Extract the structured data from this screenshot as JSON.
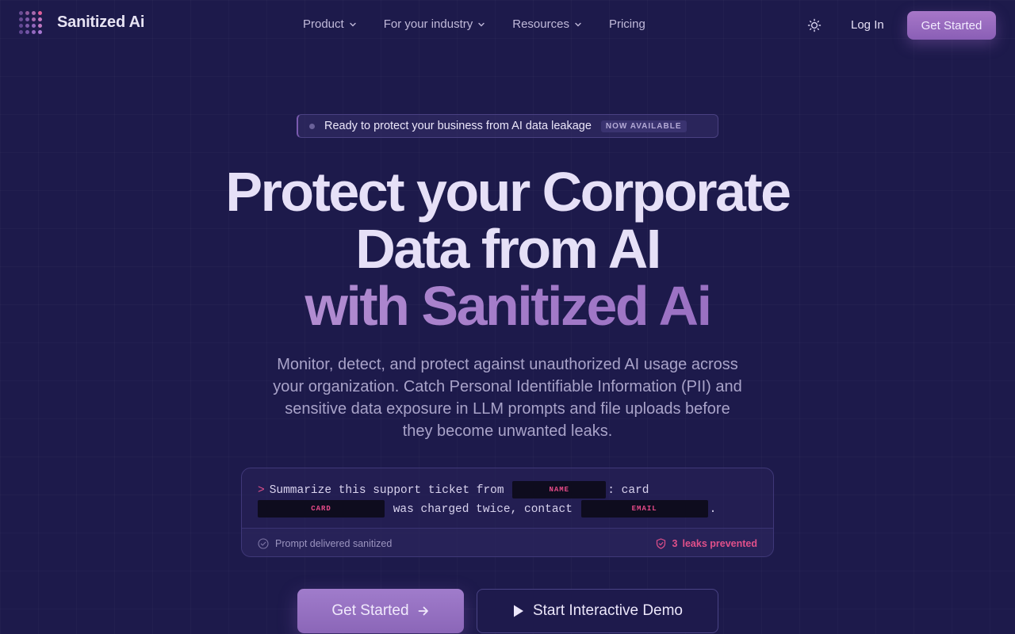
{
  "brand": {
    "name": "Sanitized Ai",
    "logo_colors": [
      "#9a6fcf",
      "#a878d2",
      "#c078c0",
      "#e05f9a"
    ]
  },
  "nav": {
    "links": [
      {
        "label": "Product",
        "has_dropdown": true
      },
      {
        "label": "For your industry",
        "has_dropdown": true
      },
      {
        "label": "Resources",
        "has_dropdown": true
      },
      {
        "label": "Pricing",
        "has_dropdown": false
      }
    ],
    "theme_icon": "sun-icon",
    "login_label": "Log In",
    "cta_label": "Get Started"
  },
  "badge": {
    "text": "Ready to protect your business from AI data leakage",
    "tag": "NOW AVAILABLE"
  },
  "hero": {
    "line1": "Protect your Corporate",
    "line2": "Data from AI",
    "line3_prefix": "with ",
    "line3_accent": "Sanitized Ai",
    "subtitle": "Monitor, detect, and protect against unauthorized AI usage across your organization. Catch Personal Identifiable Information (PII) and sensitive data exposure in LLM prompts and file uploads before they become unwanted leaks."
  },
  "terminal": {
    "prompt_symbol": ">",
    "segment1": "Summarize this support ticket from",
    "redact_name": "NAME",
    "segment2": ": card",
    "redact_card": "CARD",
    "segment3": "was charged twice, contact",
    "redact_email": "EMAIL",
    "segment4": ".",
    "status": "Prompt delivered sanitized",
    "leaks_count": "3",
    "leaks_label": "leaks prevented"
  },
  "ctas": {
    "primary": "Get Started",
    "secondary": "Start Interactive Demo"
  },
  "colors": {
    "background": "#1d1a4b",
    "accent": "#a47cc9",
    "danger": "#e0508a"
  }
}
